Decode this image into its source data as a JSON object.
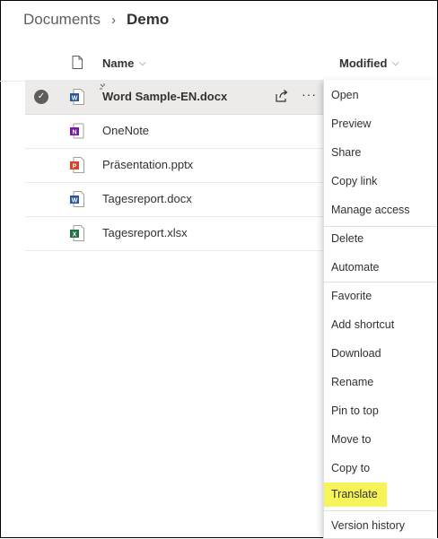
{
  "breadcrumb": {
    "parent": "Documents",
    "separator": "›",
    "current": "Demo"
  },
  "header": {
    "name_label": "Name",
    "modified_label": "Modified"
  },
  "files": [
    {
      "name": "Word Sample-EN.docx",
      "type": "word-icon",
      "selected": true
    },
    {
      "name": "OneNote",
      "type": "onenote-icon",
      "selected": false
    },
    {
      "name": "Präsentation.pptx",
      "type": "powerpoint-icon",
      "selected": false
    },
    {
      "name": "Tagesreport.docx",
      "type": "word-icon",
      "selected": false
    },
    {
      "name": "Tagesreport.xlsx",
      "type": "excel-icon",
      "selected": false
    }
  ],
  "row_actions": {
    "more": "···"
  },
  "menu": {
    "items": [
      "Open",
      "Preview",
      "Share",
      "Copy link",
      "Manage access",
      "Delete",
      "Automate",
      "Favorite",
      "Add shortcut",
      "Download",
      "Rename",
      "Pin to top",
      "Move to",
      "Copy to",
      "Translate",
      "Version history"
    ],
    "highlighted": "Translate",
    "highlight_color": "#f7f45a"
  },
  "colors": {
    "word": "#2b579a",
    "onenote": "#7719aa",
    "powerpoint": "#d24726",
    "excel": "#217346",
    "selected_row": "#edebe9"
  }
}
